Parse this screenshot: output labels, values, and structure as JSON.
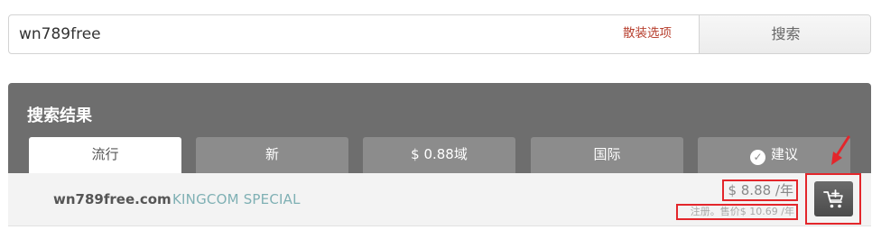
{
  "search": {
    "value": "wn789free",
    "bulk_options_label": "散装选项",
    "button_label": "搜索"
  },
  "results": {
    "title": "搜索结果",
    "tabs": [
      {
        "label": "流行",
        "active": true
      },
      {
        "label": "新",
        "active": false
      },
      {
        "label": "$ 0.88域",
        "active": false
      },
      {
        "label": "国际",
        "active": false
      },
      {
        "label": "建议",
        "active": false,
        "icon": "check-circle-icon"
      }
    ],
    "rows": [
      {
        "domain": "wn789free.com",
        "tag": "KINGCOM SPECIAL",
        "price": "$ 8.88 /年",
        "renewal": "注册。售价$ 10.69 /年",
        "action_icon": "add-to-cart-icon"
      }
    ]
  },
  "colors": {
    "panel": "#6e6e6e",
    "tab_inactive": "#8c8c8c",
    "highlight": "#e3262b",
    "bulk_link": "#b84130",
    "promo": "#7fb0b4"
  }
}
